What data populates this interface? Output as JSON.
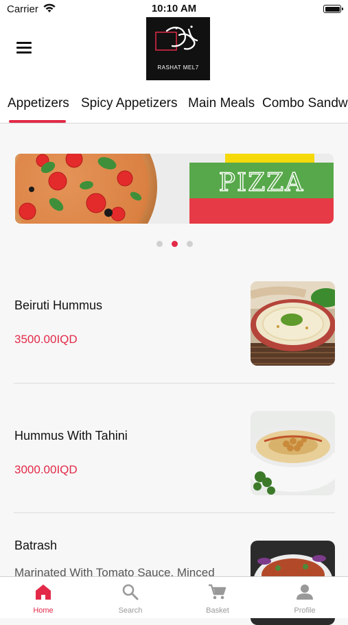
{
  "status": {
    "carrier": "Carrier",
    "time": "10:10 AM"
  },
  "header": {
    "logo_text": "RASHAT MEL7",
    "menu_icon": "hamburger-menu-icon"
  },
  "tabs": [
    {
      "label": "Appetizers",
      "active": true
    },
    {
      "label": "Spicy Appetizers",
      "active": false
    },
    {
      "label": "Main Meals",
      "active": false
    },
    {
      "label": "Combo Sandwich",
      "active": false
    }
  ],
  "banner": {
    "title": "PIZZA",
    "colors": {
      "green": "#57a84a",
      "red": "#e63b46",
      "yellow": "#f5d90a"
    }
  },
  "carousel": {
    "count": 3,
    "active_index": 1
  },
  "items": [
    {
      "name": "Beiruti Hummus",
      "price": "3500.00IQD",
      "description": ""
    },
    {
      "name": "Hummus With Tahini",
      "price": "3000.00IQD",
      "description": ""
    },
    {
      "name": "Batrash",
      "price": "",
      "description": "Marinated With Tomato Sauce, Minced"
    }
  ],
  "bottom_nav": [
    {
      "label": "Home",
      "icon": "home-icon",
      "active": true
    },
    {
      "label": "Search",
      "icon": "search-icon",
      "active": false
    },
    {
      "label": "Basket",
      "icon": "basket-icon",
      "active": false
    },
    {
      "label": "Profile",
      "icon": "profile-icon",
      "active": false
    }
  ],
  "colors": {
    "accent": "#e22a48",
    "inactive": "#999999"
  }
}
